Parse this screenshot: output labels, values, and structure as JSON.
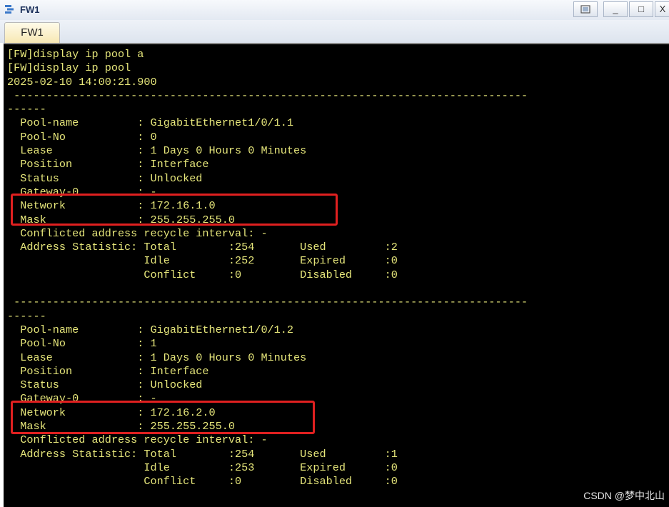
{
  "window": {
    "title": "FW1",
    "tab_label": "FW1",
    "controls": [
      "",
      "_",
      "□",
      "X"
    ]
  },
  "terminal": {
    "lines": [
      "[FW]display ip pool a",
      "[FW]display ip pool",
      "2025-02-10 14:00:21.900",
      " -------------------------------------------------------------------------------",
      "------",
      "  Pool-name         : GigabitEthernet1/0/1.1",
      "  Pool-No           : 0",
      "  Lease             : 1 Days 0 Hours 0 Minutes",
      "  Position          : Interface",
      "  Status            : Unlocked",
      "  Gateway-0         : -",
      "  Network           : 172.16.1.0",
      "  Mask              : 255.255.255.0",
      "  Conflicted address recycle interval: -",
      "  Address Statistic: Total        :254       Used         :2",
      "                     Idle         :252       Expired      :0",
      "                     Conflict     :0         Disabled     :0",
      "",
      " -------------------------------------------------------------------------------",
      "------",
      "  Pool-name         : GigabitEthernet1/0/1.2",
      "  Pool-No           : 1",
      "  Lease             : 1 Days 0 Hours 0 Minutes",
      "  Position          : Interface",
      "  Status            : Unlocked",
      "  Gateway-0         : -",
      "  Network           : 172.16.2.0",
      "  Mask              : 255.255.255.0",
      "  Conflicted address recycle interval: -",
      "  Address Statistic: Total        :254       Used         :1",
      "                     Idle         :253       Expired      :0",
      "                     Conflict     :0         Disabled     :0"
    ]
  },
  "watermark": "CSDN @梦中北山",
  "colors": {
    "terminal_bg": "#000000",
    "terminal_text": "#e5e57a",
    "highlight": "#e02020"
  }
}
